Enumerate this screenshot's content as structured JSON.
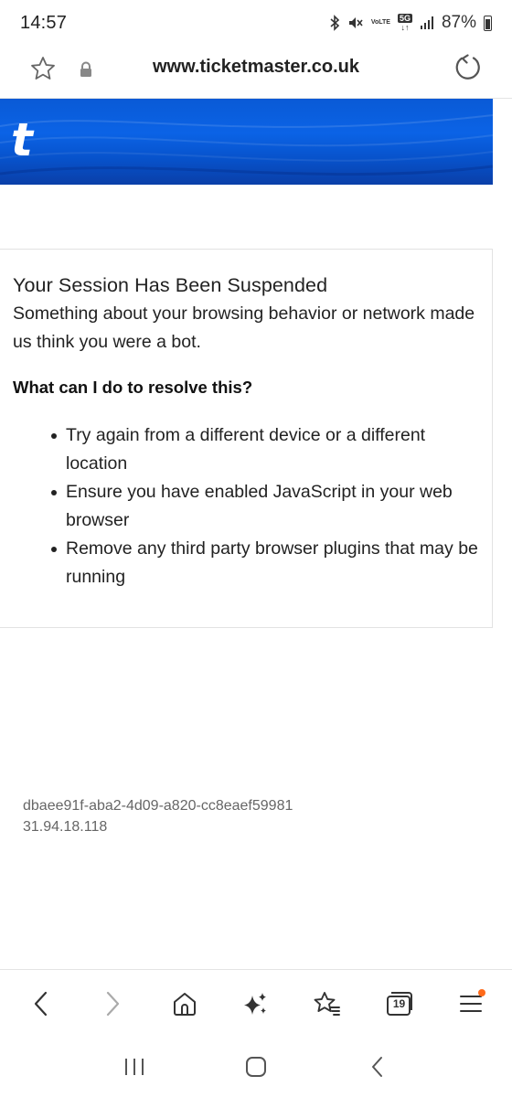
{
  "status_bar": {
    "time": "14:57",
    "volte_label": "VoLTE",
    "network_label": "5G",
    "battery": "87%",
    "icons": [
      "bluetooth-icon",
      "mute-icon",
      "volte-icon",
      "5g-icon",
      "signal-icon",
      "battery-icon"
    ]
  },
  "browser": {
    "url": "www.ticketmaster.co.uk",
    "tab_count": "19",
    "icons": [
      "favourite-star-icon",
      "lock-icon",
      "reload-icon"
    ]
  },
  "banner": {
    "logo_text": "t",
    "color": "#0a5ad6"
  },
  "content": {
    "title": "Your Session Has Been Suspended",
    "lead": "Something about your browsing behavior or network made us think you were a bot.",
    "question": "What can I do to resolve this?",
    "items": [
      "Try again from a different device or a different location",
      "Ensure you have enabled JavaScript in your web browser",
      "Remove any third party browser plugins that may be running"
    ]
  },
  "footer": {
    "session_id": "dbaee91f-aba2-4d09-a820-cc8eaef59981",
    "ip": "31.94.18.118"
  },
  "toolbar": {
    "icons": [
      "back-icon",
      "forward-icon",
      "home-icon",
      "sparkle-icon",
      "bookmarks-icon",
      "tabs-icon",
      "menu-icon"
    ],
    "accent": "#ff6a1a"
  },
  "nav_bar": {
    "icons": [
      "recents-icon",
      "home-nav-icon",
      "back-nav-icon"
    ]
  }
}
